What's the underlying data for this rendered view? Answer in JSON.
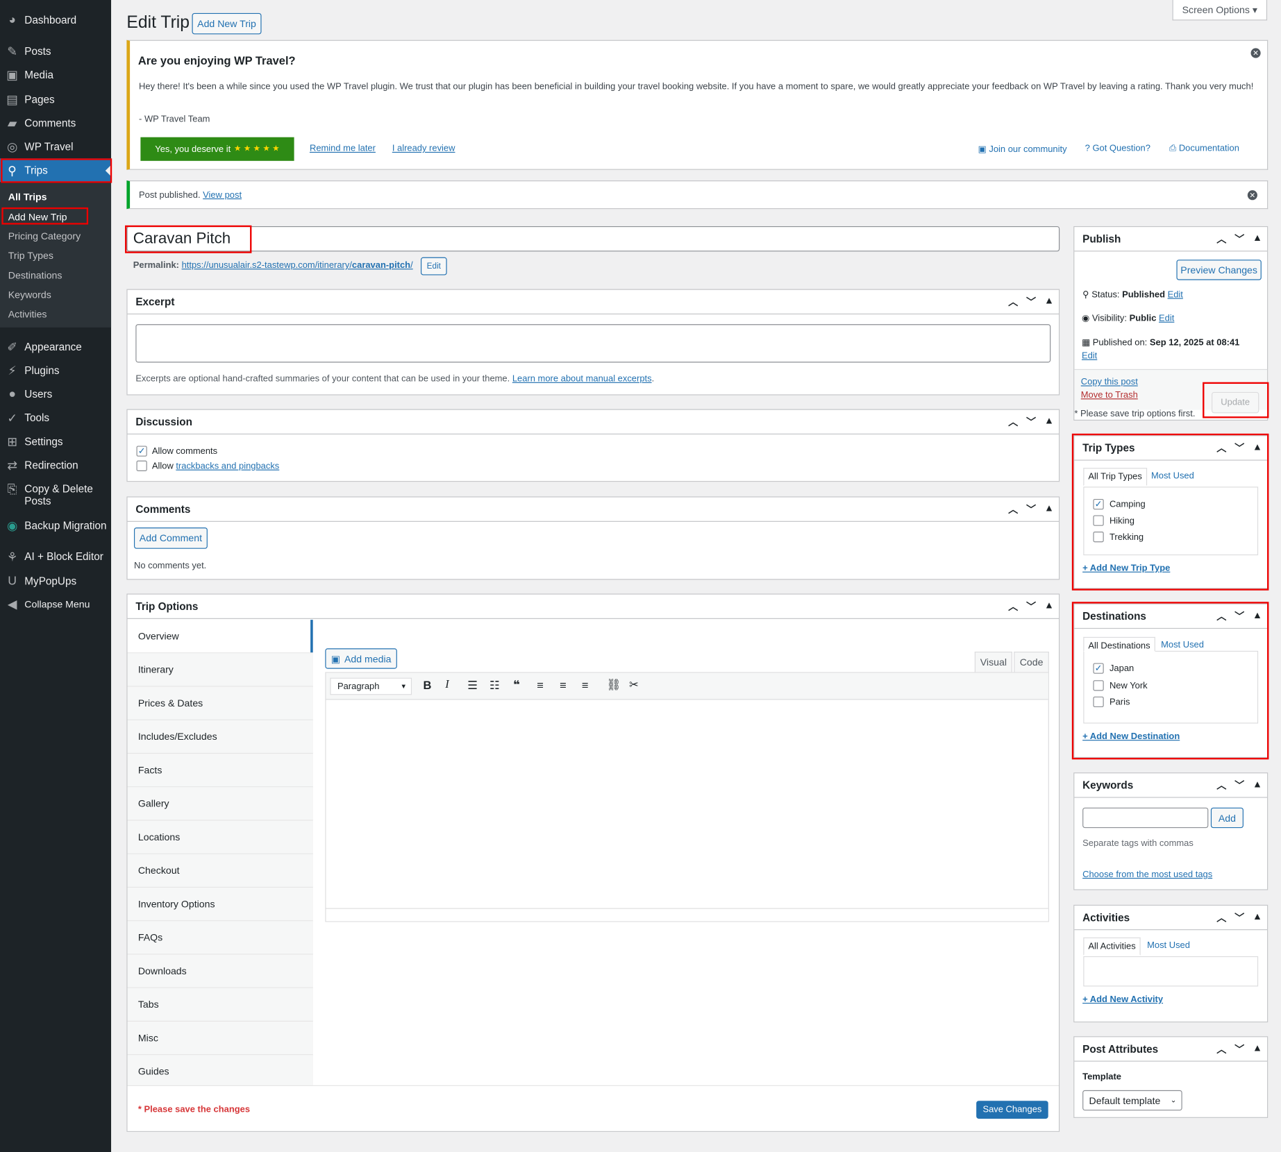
{
  "sidebar": {
    "items": [
      {
        "label": "Dashboard",
        "icon": "dashboard-icon"
      },
      {
        "label": "Posts",
        "icon": "pin-icon"
      },
      {
        "label": "Media",
        "icon": "media-icon"
      },
      {
        "label": "Pages",
        "icon": "pages-icon"
      },
      {
        "label": "Comments",
        "icon": "comments-icon"
      },
      {
        "label": "WP Travel",
        "icon": "compass-icon"
      },
      {
        "label": "Trips",
        "icon": "location-icon"
      },
      {
        "label": "Appearance",
        "icon": "brush-icon"
      },
      {
        "label": "Plugins",
        "icon": "plugin-icon"
      },
      {
        "label": "Users",
        "icon": "user-icon"
      },
      {
        "label": "Tools",
        "icon": "wrench-icon"
      },
      {
        "label": "Settings",
        "icon": "settings-icon"
      },
      {
        "label": "Redirection",
        "icon": "redirect-icon"
      },
      {
        "label": "Copy & Delete",
        "label2": "Posts",
        "icon": "copy-icon"
      },
      {
        "label": "Backup Migration",
        "icon": "backup-icon"
      },
      {
        "label": "AI + Block Editor",
        "icon": "ai-icon"
      },
      {
        "label": "MyPopUps",
        "icon": "popup-icon"
      },
      {
        "label": "Collapse Menu",
        "icon": "collapse-icon"
      }
    ],
    "submenu": [
      "All Trips",
      "Add New Trip",
      "Pricing Category",
      "Trip Types",
      "Destinations",
      "Keywords",
      "Activities"
    ]
  },
  "header": {
    "title": "Edit Trip",
    "add_new": "Add New Trip",
    "screen_options": "Screen Options ▾"
  },
  "review_notice": {
    "title": "Are you enjoying WP Travel?",
    "body": "Hey there! It's been a while since you used the WP Travel plugin. We trust that our plugin has been beneficial in building your travel booking website. If you have a moment to spare, we would greatly appreciate your feedback on WP Travel by leaving a rating. Thank you very much!",
    "signature": "- WP Travel Team",
    "rate_button": "Yes, you deserve it",
    "stars": "★ ★ ★ ★ ★",
    "remind": "Remind me later",
    "already": "I already review",
    "community": "Join our community",
    "question": "Got Question?",
    "docs": "Documentation"
  },
  "publish_notice": {
    "text": "Post published.",
    "link": "View post"
  },
  "post": {
    "title": "Caravan Pitch",
    "permalink_label": "Permalink:",
    "permalink_base": "https://unusualair.s2-tastewp.com/itinerary/",
    "permalink_slug": "caravan-pitch",
    "permalink_end": "/",
    "edit": "Edit"
  },
  "excerpt": {
    "title": "Excerpt",
    "help": "Excerpts are optional hand-crafted summaries of your content that can be used in your theme.",
    "help_link": "Learn more about manual excerpts",
    "help_end": "."
  },
  "discussion": {
    "title": "Discussion",
    "allow_comments": "Allow comments",
    "allow": "Allow",
    "trackbacks": "trackbacks and pingbacks"
  },
  "comments": {
    "title": "Comments",
    "add": "Add Comment",
    "none": "No comments yet."
  },
  "trip_options": {
    "title": "Trip Options",
    "tabs": [
      "Overview",
      "Itinerary",
      "Prices & Dates",
      "Includes/Excludes",
      "Facts",
      "Gallery",
      "Locations",
      "Checkout",
      "Inventory Options",
      "FAQs",
      "Downloads",
      "Tabs",
      "Misc",
      "Guides"
    ],
    "add_media": "Add media",
    "visual": "Visual",
    "code": "Code",
    "format": "Paragraph",
    "warning": "* Please save the changes",
    "save": "Save Changes"
  },
  "publish": {
    "title": "Publish",
    "preview": "Preview Changes",
    "status_label": "Status:",
    "status": "Published",
    "visibility_label": "Visibility:",
    "visibility": "Public",
    "published_label": "Published on:",
    "published": "Sep 12, 2025 at 08:41",
    "edit": "Edit",
    "copy": "Copy this post",
    "trash": "Move to Trash",
    "update": "Update",
    "note": "* Please save trip options first."
  },
  "trip_types": {
    "title": "Trip Types",
    "tab_all": "All Trip Types",
    "tab_most": "Most Used",
    "items": [
      {
        "label": "Camping",
        "checked": true
      },
      {
        "label": "Hiking",
        "checked": false
      },
      {
        "label": "Trekking",
        "checked": false
      }
    ],
    "add": "+ Add New Trip Type"
  },
  "destinations": {
    "title": "Destinations",
    "tab_all": "All Destinations",
    "tab_most": "Most Used",
    "items": [
      {
        "label": "Japan",
        "checked": true
      },
      {
        "label": "New York",
        "checked": false
      },
      {
        "label": "Paris",
        "checked": false
      }
    ],
    "add": "+ Add New Destination"
  },
  "keywords": {
    "title": "Keywords",
    "add": "Add",
    "help": "Separate tags with commas",
    "choose": "Choose from the most used tags"
  },
  "activities": {
    "title": "Activities",
    "tab_all": "All Activities",
    "tab_most": "Most Used",
    "add": "+ Add New Activity"
  },
  "post_attributes": {
    "title": "Post Attributes",
    "template_label": "Template",
    "template": "Default template"
  },
  "colors": {
    "sidebar": "#1d2327",
    "accent": "#2271b1",
    "green": "#2e8b15",
    "highlight": "#e00000"
  }
}
